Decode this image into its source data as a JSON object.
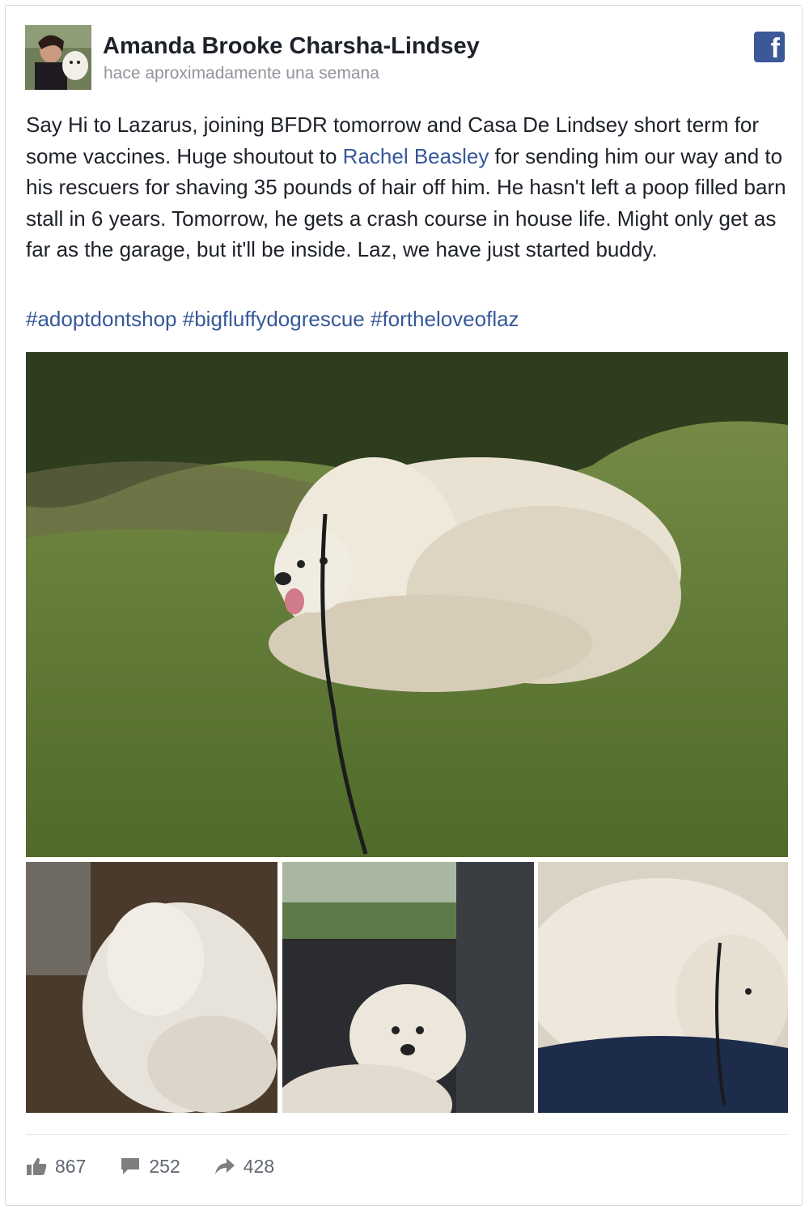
{
  "post": {
    "author": "Amanda Brooke Charsha-Lindsey",
    "timestamp": "hace aproximadamente una semana",
    "text_part1": "Say Hi to Lazarus, joining BFDR tomorrow and Casa De Lindsey short term for some vaccines. Huge shoutout to ",
    "mention": "Rachel Beasley",
    "text_part2": " for sending him our way and to his rescuers for shaving 35 pounds of hair off him. He hasn't left a poop filled barn stall in 6 years. Tomorrow, he gets a crash course in house life. Might only get as far as the garage, but it'll be inside. Laz, we have just started buddy.",
    "hashtags": [
      "#adoptdontshop",
      "#bigfluffydogrescue",
      "#fortheloveoflaz"
    ],
    "brand_icon": "facebook-icon",
    "brand_color": "#3b5998",
    "link_color": "#365899"
  },
  "stats": {
    "likes": "867",
    "comments": "252",
    "shares": "428"
  },
  "icons": {
    "like": "thumbs-up-icon",
    "comment": "comment-icon",
    "share": "share-arrow-icon"
  }
}
